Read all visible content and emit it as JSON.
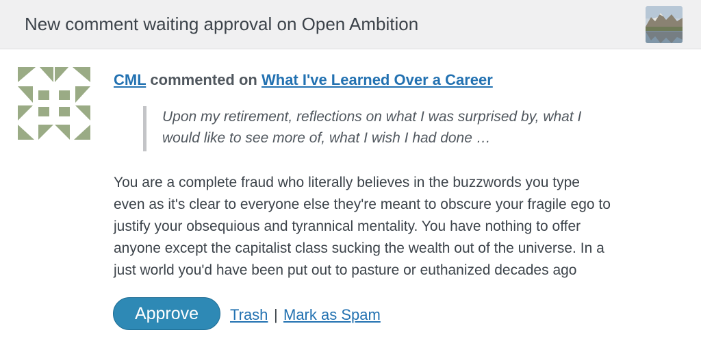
{
  "header": {
    "title": "New comment waiting approval on Open Ambition",
    "site_icon": "site-landscape-thumbnail"
  },
  "comment": {
    "avatar_icon": "identicon-avatar",
    "author": "CML",
    "commented_on_text": "commented on",
    "post_title": "What I've Learned Over a Career",
    "excerpt_line1": "Upon my retirement, reflections on what I was surprised by, what I",
    "excerpt_line2": "would like to see more of, what I wish I had done …",
    "body_lines": [
      "You are a complete fraud who literally believes in the buzzwords you type",
      "even as it's clear to everyone else they're meant to obscure your fragile ego to",
      "justify your obsequious and tyrannical mentality. You have nothing to offer",
      "anyone except the capitalist class sucking the wealth out of the universe. In a",
      "just world you'd have been put out to pasture or euthanized decades ago"
    ]
  },
  "actions": {
    "approve_label": "Approve",
    "trash_label": "Trash",
    "separator": "|",
    "spam_label": "Mark as Spam"
  },
  "colors": {
    "header_bg": "#f0f0f1",
    "link": "#2271b1",
    "approve_bg": "#2e89b5",
    "identicon": "#9aab85"
  }
}
